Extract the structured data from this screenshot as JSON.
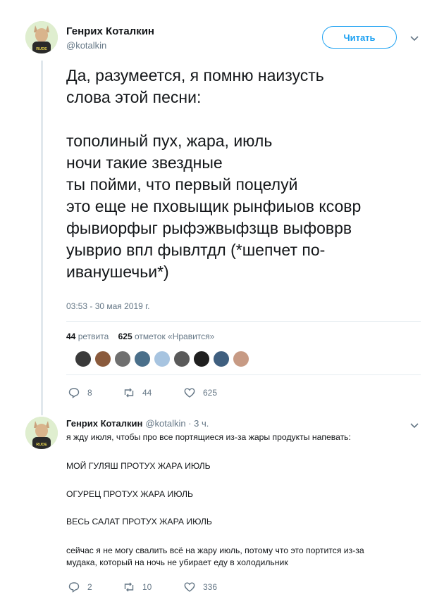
{
  "tweet": {
    "author_name": "Генрих Коталкин",
    "author_handle": "@kotalkin",
    "follow_label": "Читать",
    "text": "Да, разумеется, я помню наизусть\nслова этой песни:\n\nтополиный пух, жара, июль\nночи такие звездные\nты пойми, что первый поцелуй\nэто еще не пховыщик рынфиыов ксовр\nфывиорфыг рыфэжвыфзщв выфоврв\nуыврио впл фывлтдл (*шепчет по-\nиванушечьи*)",
    "timestamp": "03:53 - 30 мая 2019 г.",
    "retweets_count": "44",
    "retweets_label": "ретвита",
    "likes_count": "625",
    "likes_label": "отметок «Нравится»",
    "likers": [
      "#3a3a3a",
      "#8a5a3c",
      "#6f6f6f",
      "#4a6f8a",
      "#a7c4e0",
      "#5a5a5a",
      "#1f1f1f",
      "#3f5f7f",
      "#c79a84"
    ],
    "actions": {
      "replies": "8",
      "retweets": "44",
      "likes": "625"
    }
  },
  "reply": {
    "author_name": "Генрих Коталкин",
    "author_handle": "@kotalkin · 3 ч.",
    "paragraphs": [
      "я жду июля, чтобы про все портящиеся из-за жары продукты напевать:",
      "МОЙ ГУЛЯШ ПРОТУХ ЖАРА ИЮЛЬ",
      "ОГУРЕЦ ПРОТУХ ЖАРА ИЮЛЬ",
      "ВЕСЬ САЛАТ ПРОТУХ ЖАРА ИЮЛЬ",
      "сейчас я не могу свалить всё на жару июль, потому что это портится из-за\nмудака, который на ночь не убирает еду в холодильник"
    ],
    "actions": {
      "replies": "2",
      "retweets": "10",
      "likes": "336"
    }
  },
  "avatar_badge": "RUDE",
  "colors": {
    "accent": "#1da1f2",
    "muted": "#657786",
    "text": "#14171a",
    "thread_line": "#e1e8ed"
  }
}
